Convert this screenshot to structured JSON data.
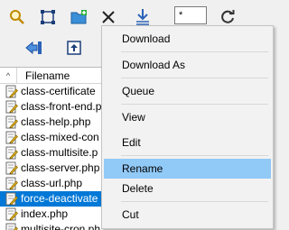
{
  "toolbar": {
    "filter_value": "*",
    "buttons": [
      "search-icon",
      "select-region-icon",
      "new-folder-icon",
      "delete-x-icon",
      "download-arrow-icon",
      "refresh-icon",
      "back-arrow-icon",
      "up-folder-icon"
    ]
  },
  "filelist": {
    "sort_indicator": "^",
    "column_filename": "Filename",
    "rows": [
      {
        "name": "class-certificate",
        "selected": false
      },
      {
        "name": "class-front-end.p",
        "selected": false
      },
      {
        "name": "class-help.php",
        "selected": false
      },
      {
        "name": "class-mixed-con",
        "selected": false
      },
      {
        "name": "class-multisite.p",
        "selected": false
      },
      {
        "name": "class-server.php",
        "selected": false
      },
      {
        "name": "class-url.php",
        "selected": false
      },
      {
        "name": "force-deactivate",
        "selected": true
      },
      {
        "name": "index.php",
        "selected": false
      },
      {
        "name": "multisite-cron.ph",
        "selected": false
      }
    ]
  },
  "context_menu": {
    "items": [
      {
        "label": "Download",
        "highlighted": false
      },
      {
        "label": "Download As",
        "highlighted": false
      },
      {
        "label": "Queue",
        "highlighted": false
      },
      {
        "label": "View",
        "highlighted": false
      },
      {
        "label": "Edit",
        "highlighted": false
      },
      {
        "label": "Rename",
        "highlighted": true
      },
      {
        "label": "Delete",
        "highlighted": false
      },
      {
        "label": "Cut",
        "highlighted": false
      }
    ]
  },
  "colors": {
    "selection": "#0078d7",
    "menu_highlight": "#91c9f7",
    "menu_background": "#f2f2f2"
  }
}
